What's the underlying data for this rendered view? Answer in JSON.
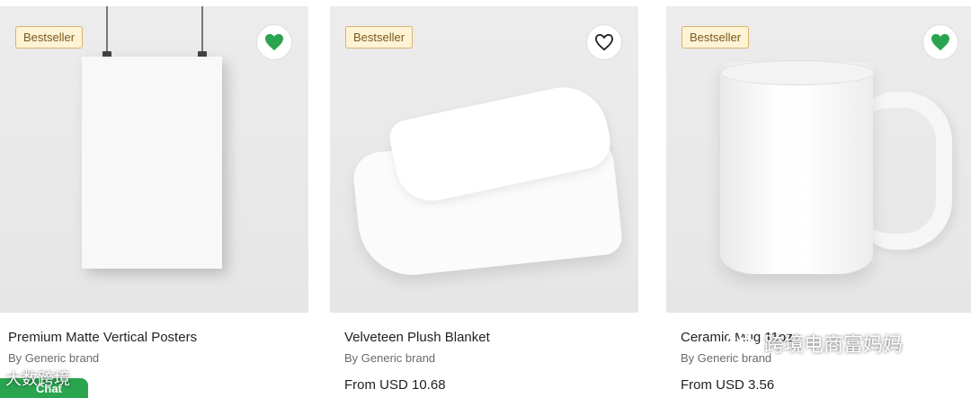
{
  "products": [
    {
      "badge": "Bestseller",
      "title": "Premium Matte Vertical Posters",
      "brand": "By Generic brand",
      "favorited": true
    },
    {
      "badge": "Bestseller",
      "title": "Velveteen Plush Blanket",
      "brand": "By Generic brand",
      "price": "From USD 10.68",
      "favorited": false
    },
    {
      "badge": "Bestseller",
      "title": "Ceramic Mug 11oz",
      "brand": "By Generic brand",
      "price": "From USD 3.56",
      "favorited": true
    }
  ],
  "chat": {
    "label": "Chat"
  },
  "watermarks": {
    "left": "大数跨境",
    "right": "跨境电商富妈妈"
  },
  "colors": {
    "favorite_fill": "#2aa44f",
    "chat_green": "#2aa44f",
    "badge_bg": "#fff3d6"
  }
}
